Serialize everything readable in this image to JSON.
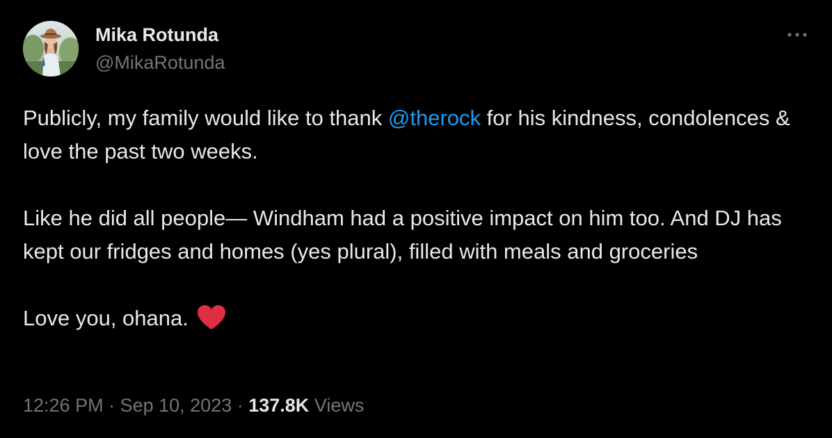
{
  "author": {
    "display_name": "Mika Rotunda",
    "handle": "@MikaRotunda",
    "avatar_icon": "profile-photo"
  },
  "more_icon": "ellipsis-icon",
  "tweet": {
    "p1_before": "Publicly, my family would like to thank ",
    "p1_mention": "@therock",
    "p1_after": " for his kindness, condolences & love the past two weeks.",
    "p2": "Like he did all people— Windham had a positive impact on him too. And DJ has kept our fridges and homes (yes plural), filled with meals and groceries",
    "p3": "Love you, ohana.",
    "p3_emoji": "red-heart-emoji"
  },
  "meta": {
    "time": "12:26 PM",
    "sep1": " · ",
    "date": "Sep 10, 2023",
    "sep2": " · ",
    "views_count": "137.8K",
    "views_label": " Views"
  },
  "colors": {
    "background": "#000000",
    "text": "#e7e9ea",
    "secondary": "#71767b",
    "link": "#1d9bf0",
    "heart": "#dd2e44"
  }
}
